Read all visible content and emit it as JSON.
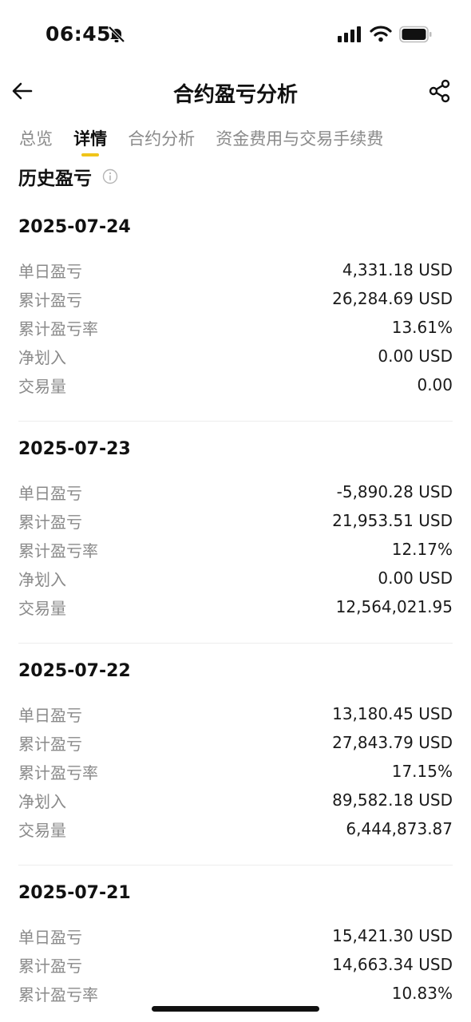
{
  "status_bar": {
    "time": "06:45"
  },
  "header": {
    "title": "合约盈亏分析"
  },
  "tabs": [
    "总览",
    "详情",
    "合约分析",
    "资金费用与交易手续费"
  ],
  "active_tab": "详情",
  "section": {
    "title": "历史盈亏"
  },
  "days": [
    {
      "date": "2025-07-24",
      "rows": [
        {
          "label": "单日盈亏",
          "value": "4,331.18 USD"
        },
        {
          "label": "累计盈亏",
          "value": "26,284.69 USD"
        },
        {
          "label": "累计盈亏率",
          "value": "13.61%"
        },
        {
          "label": "净划入",
          "value": "0.00 USD"
        },
        {
          "label": "交易量",
          "value": "0.00"
        }
      ]
    },
    {
      "date": "2025-07-23",
      "rows": [
        {
          "label": "单日盈亏",
          "value": "-5,890.28 USD"
        },
        {
          "label": "累计盈亏",
          "value": "21,953.51 USD"
        },
        {
          "label": "累计盈亏率",
          "value": "12.17%"
        },
        {
          "label": "净划入",
          "value": "0.00 USD"
        },
        {
          "label": "交易量",
          "value": "12,564,021.95"
        }
      ]
    },
    {
      "date": "2025-07-22",
      "rows": [
        {
          "label": "单日盈亏",
          "value": "13,180.45 USD"
        },
        {
          "label": "累计盈亏",
          "value": "27,843.79 USD"
        },
        {
          "label": "累计盈亏率",
          "value": "17.15%"
        },
        {
          "label": "净划入",
          "value": "89,582.18 USD"
        },
        {
          "label": "交易量",
          "value": "6,444,873.87"
        }
      ]
    },
    {
      "date": "2025-07-21",
      "rows": [
        {
          "label": "单日盈亏",
          "value": "15,421.30 USD"
        },
        {
          "label": "累计盈亏",
          "value": "14,663.34 USD"
        },
        {
          "label": "累计盈亏率",
          "value": "10.83%"
        }
      ]
    }
  ],
  "colors": {
    "accent": "#f0c419",
    "label": "#8a8a8a",
    "text": "#111111",
    "divider": "#ededed"
  },
  "icons": [
    "mute-bell-icon",
    "signal-icon",
    "wifi-icon",
    "battery-icon",
    "back-arrow-icon",
    "share-icon",
    "info-icon"
  ]
}
